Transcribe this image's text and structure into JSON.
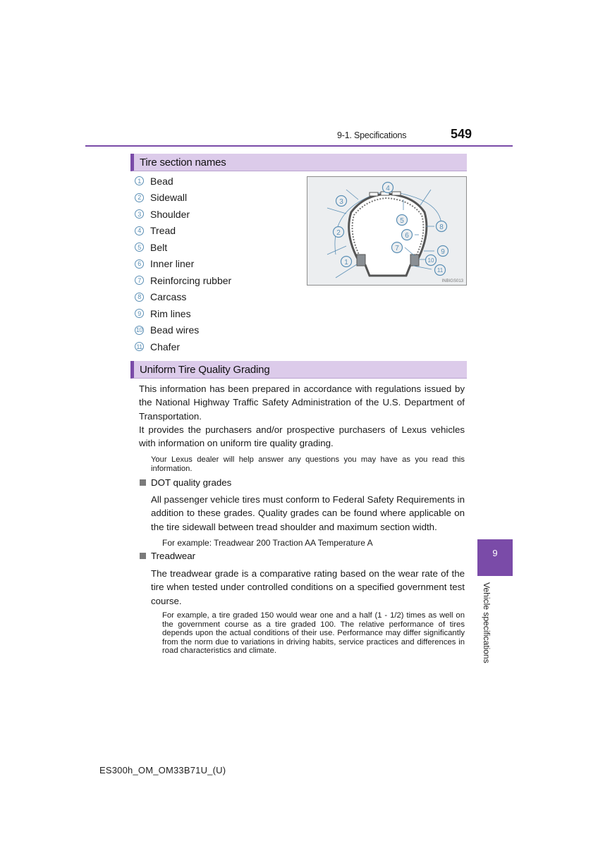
{
  "header": {
    "section": "9-1. Specifications",
    "page_number": "549"
  },
  "tire_section": {
    "title": "Tire section names",
    "items": [
      {
        "num": "1",
        "label": "Bead"
      },
      {
        "num": "2",
        "label": "Sidewall"
      },
      {
        "num": "3",
        "label": "Shoulder"
      },
      {
        "num": "4",
        "label": "Tread"
      },
      {
        "num": "5",
        "label": "Belt"
      },
      {
        "num": "6",
        "label": "Inner liner"
      },
      {
        "num": "7",
        "label": "Reinforcing rubber"
      },
      {
        "num": "8",
        "label": "Carcass"
      },
      {
        "num": "9",
        "label": "Rim lines"
      },
      {
        "num": "10",
        "label": "Bead wires"
      },
      {
        "num": "11",
        "label": "Chafer"
      }
    ],
    "diagram_code": "INBIGS013"
  },
  "utqg": {
    "title": "Uniform Tire Quality Grading",
    "intro_p1": "This information has been prepared in accordance with regulations issued by the National Highway Traffic Safety Administration of the U.S. Department of Transportation.",
    "intro_p2": "It provides the purchasers and/or prospective purchasers of Lexus vehicles with information on uniform tire quality grading.",
    "dealer_note": "Your Lexus dealer will help answer any questions you may have as you read this information.",
    "dot": {
      "heading": "DOT quality grades",
      "body": "All passenger vehicle tires must conform to Federal Safety Requirements in addition to these grades. Quality grades can be found where applicable on the tire sidewall between tread shoulder and maximum section width.",
      "example": "For example: Treadwear 200 Traction AA Temperature A"
    },
    "treadwear": {
      "heading": "Treadwear",
      "body": "The treadwear grade is a comparative rating based on the wear rate of the tire when tested under controlled conditions on a specified government test course.",
      "note": "For example, a tire graded 150 would wear one and a half (1 - 1/2) times as well on the government course as a tire graded 100. The relative performance of tires depends upon the actual conditions of their use. Performance may differ significantly from the norm due to variations in driving habits, service practices and differences in road characteristics and climate."
    }
  },
  "side_tab": {
    "number": "9",
    "label": "Vehicle specifications"
  },
  "footer": {
    "doc_id": "ES300h_OM_OM33B71U_(U)"
  },
  "colors": {
    "accent": "#7a4ba8",
    "section_bg": "#dccbea",
    "callout": "#5b8fb5"
  }
}
